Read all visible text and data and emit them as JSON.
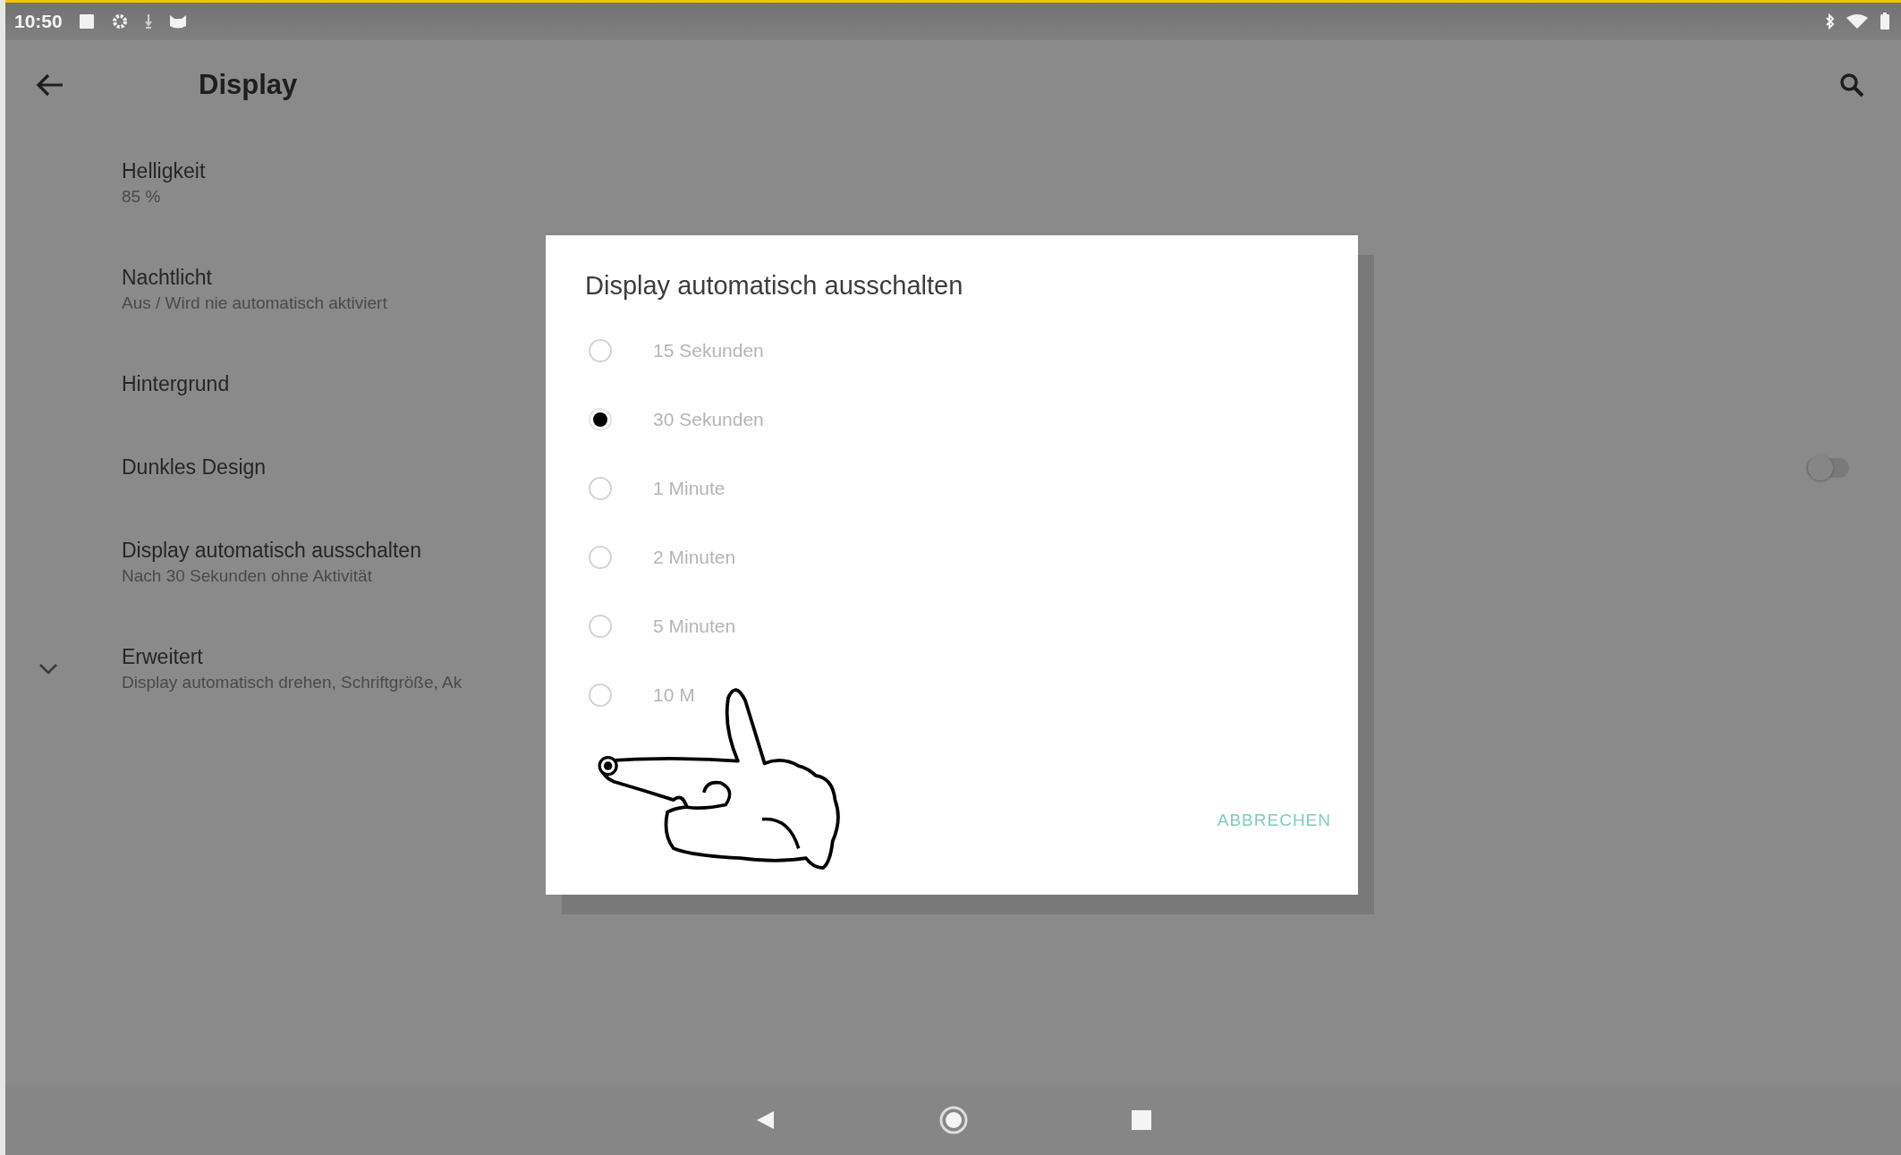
{
  "status_bar": {
    "time": "10:50"
  },
  "app_bar": {
    "title": "Display"
  },
  "settings": [
    {
      "kind": "plain",
      "title": "Helligkeit",
      "subtitle": "85 %"
    },
    {
      "kind": "plain",
      "title": "Nachtlicht",
      "subtitle": "Aus / Wird nie automatisch aktiviert"
    },
    {
      "kind": "plain",
      "title": "Hintergrund"
    },
    {
      "kind": "switch",
      "title": "Dunkles Design",
      "on": false
    },
    {
      "kind": "plain",
      "title": "Display automatisch ausschalten",
      "subtitle": "Nach 30 Sekunden ohne Aktivität"
    },
    {
      "kind": "expander",
      "title": "Erweitert",
      "subtitle": "Display automatisch drehen, Schriftgröße, Ak",
      "expanded": false
    }
  ],
  "dialog": {
    "title": "Display automatisch ausschalten",
    "options": [
      {
        "label": "15 Sekunden",
        "selected": false
      },
      {
        "label": "30 Sekunden",
        "selected": true
      },
      {
        "label": "1 Minute",
        "selected": false
      },
      {
        "label": "2 Minuten",
        "selected": false
      },
      {
        "label": "5 Minuten",
        "selected": false
      },
      {
        "label": "10 M",
        "selected": false
      }
    ],
    "cancel": "ABBRECHEN"
  }
}
